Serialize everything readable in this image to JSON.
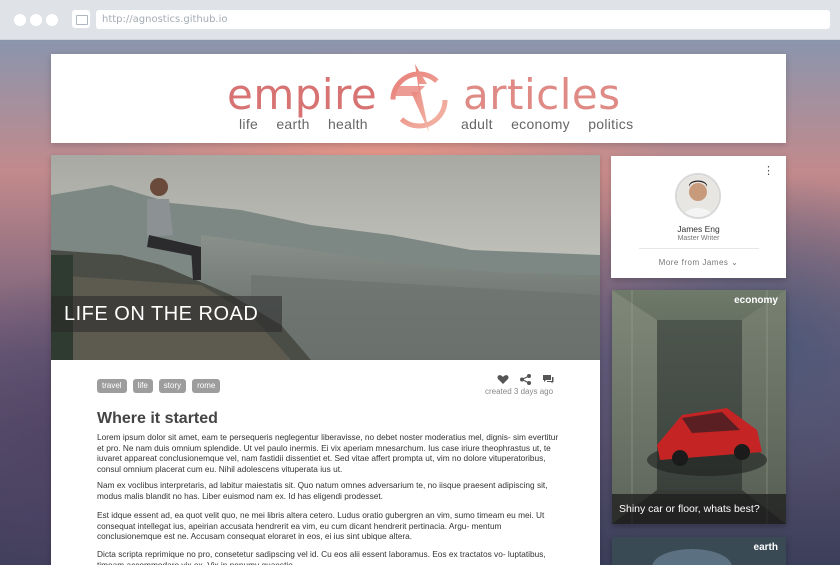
{
  "browser": {
    "url": "http://agnostics.github.io"
  },
  "site": {
    "brand_left": "empire",
    "brand_right": "articles",
    "nav_left": [
      "life",
      "earth",
      "health"
    ],
    "nav_right": [
      "adult",
      "economy",
      "politics"
    ],
    "brand_color": "#d87373"
  },
  "article": {
    "title": "LIFE ON THE ROAD",
    "tags": [
      "travel",
      "life",
      "story",
      "rome"
    ],
    "created": "created 3 days ago",
    "heading": "Where it started",
    "paragraphs": [
      "Lorem ipsum dolor sit amet, eam te persequeris neglegentur liberavisse, no debet noster moderatius mel, dignis- sim evertitur et pro. Ne nam duis omnium splendide. Ut vel paulo inermis. Ei vix aperiam mnesarchum. Ius case iriure theophrastus ut, te iuvaret appareat conclusionemque vel, nam fastidii dissentiet et. Sed vitae affert prompta ut, vim no dolore vituperatoribus, consul omnium placerat cum eu. Nihil adolescens vituperata ius ut.",
      "Nam ex voclibus interpretaris, ad labitur maiestatis sit. Quo natum omnes adversarium te, no iisque praesent adipiscing sit, modus malis blandit no has. Liber euismod nam ex. Id has eligendi prodesset.",
      "Est idque essent ad, ea quot velit quo, ne mei libris altera cetero. Ludus oratio gubergren an vim, sumo timeam eu mei. Ut consequat intellegat ius, apeirian accusata hendrerit ea vim, eu cum dicant hendrerit pertinacia. Argu- mentum conclusionemque est ne. Accusam consequat eloraret in eos, ei ius sint ubique altera.",
      "Dicta scripta reprimique no pro, consetetur sadipscing vel id. Cu eos alii essent laboramus. Eos ex tractatos vo- luptatibus, timeam accommodare vix ex. Vix in nonumy quaestio."
    ]
  },
  "author": {
    "name": "James Eng",
    "role": "Master Writer",
    "more_label": "More from James"
  },
  "side_cards": [
    {
      "category": "economy",
      "title": "Shiny car or floor, whats best?"
    },
    {
      "category": "earth",
      "title": ""
    }
  ]
}
